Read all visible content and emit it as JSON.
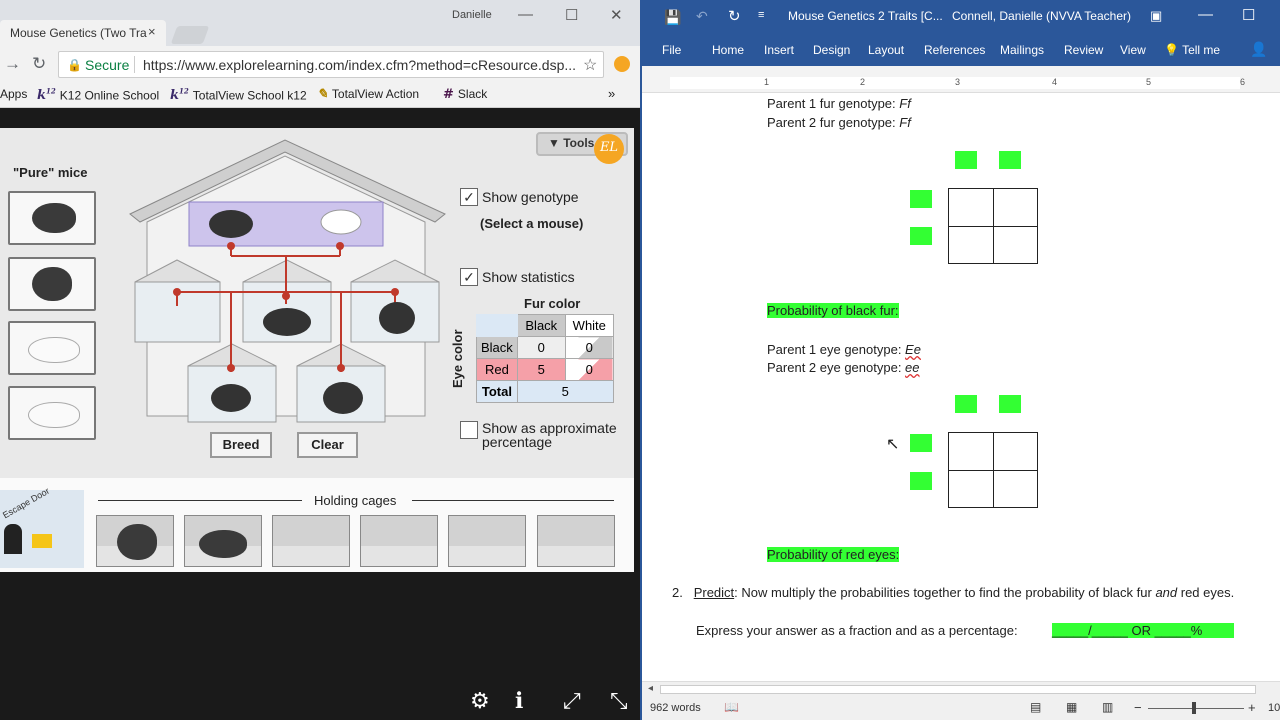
{
  "chrome": {
    "tab_title": "Mouse Genetics (Two Tra",
    "tab_close": "×",
    "window_user": "Danielle",
    "window_controls": {
      "min": "—",
      "max": "☐",
      "close": "✕"
    },
    "nav": {
      "back": "←",
      "forward": "→",
      "reload": "↻"
    },
    "secure_label": "Secure",
    "url": "https://www.explorelearning.com/index.cfm?method=cResource.dsp...",
    "star": "☆",
    "bookmarks": [
      {
        "icon": "apps-icon",
        "label": "Apps"
      },
      {
        "icon": "k12",
        "label": "K12 Online School"
      },
      {
        "icon": "k12",
        "label": "TotalView School k12"
      },
      {
        "icon": "k12",
        "label": "TotalView Action"
      },
      {
        "icon": "slack",
        "label": "Slack"
      }
    ],
    "bookmarks_more": "»",
    "bm_k12_glyph": "k",
    "bm_k12_sup": "12"
  },
  "gizmo": {
    "tools_label": "Tools",
    "logo": "EL",
    "pure_title": "\"Pure\" mice",
    "show_genotype": "Show genotype",
    "select_mouse": "(Select a mouse)",
    "show_statistics": "Show statistics",
    "checked": "✓",
    "fur_color": "Fur color",
    "eye_color": "Eye color",
    "table": {
      "col_black": "Black",
      "col_white": "White",
      "row_black": "Black",
      "row_red": "Red",
      "row_total": "Total",
      "black_black": "0",
      "black_white": "0",
      "red_black": "5",
      "red_white": "0",
      "total": "5"
    },
    "show_approx": "Show as approximate percentage",
    "breed": "Breed",
    "clear": "Clear",
    "holding_cages": "Holding cages",
    "escape_door": "Escape Door"
  },
  "bottom_bar": {
    "settings": "⚙",
    "info": "ℹ",
    "expand": "⤢",
    "collapse": "⤡"
  },
  "word": {
    "title": "Mouse Genetics 2 Traits [C...",
    "user": "Connell, Danielle (NVVA Teacher)",
    "ribbon_tabs": [
      "File",
      "Home",
      "Insert",
      "Design",
      "Layout",
      "References",
      "Mailings",
      "Review",
      "View"
    ],
    "tell_me": "Tell me",
    "ruler_numbers": [
      "1",
      "2",
      "3",
      "4",
      "5",
      "6"
    ],
    "doc": {
      "p1_fur": "Parent 1 fur genotype: ",
      "p1_fur_val": "Ff",
      "p2_fur": "Parent 2 fur genotype: ",
      "p2_fur_val": "Ff",
      "prob_black": "Probability of black fur:",
      "p1_eye": "Parent 1 eye genotype: ",
      "p1_eye_val": "Ee",
      "p2_eye": "Parent 2 eye genotype: ",
      "p2_eye_val": "ee",
      "prob_red": "Probability of red eyes:",
      "q_num": "2.",
      "predict": "Predict",
      "predict_text_1": ": Now multiply the probabilities together to find the probability of black fur ",
      "predict_and": "and",
      "predict_text_2": " red eyes.",
      "express": "Express your answer as a fraction and as a percentage:",
      "answer_blank": "_____/_____    OR       _____%"
    },
    "word_count": "962 words",
    "zoom_minus": "−",
    "zoom_plus": "+",
    "zoom_pct": "10"
  }
}
